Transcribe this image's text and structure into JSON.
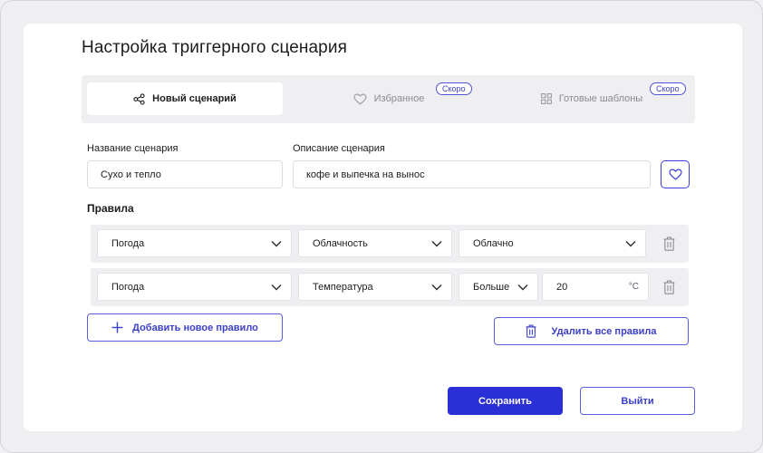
{
  "page": {
    "title": "Настройка триггерного сценария"
  },
  "tabs": [
    {
      "label": "Новый сценарий",
      "icon": "share-nodes-icon",
      "active": true
    },
    {
      "label": "Избранное",
      "icon": "heart-icon",
      "badge": "Скоро"
    },
    {
      "label": "Готовые шаблоны",
      "icon": "grid-icon",
      "badge": "Скоро"
    }
  ],
  "form": {
    "name_label": "Название сценария",
    "name_value": "Сухо и тепло",
    "description_label": "Описание сценария",
    "description_value": "кофе и выпечка на вынос",
    "favorite_icon": "heart-icon"
  },
  "rules": {
    "title": "Правила",
    "rows": [
      {
        "source": "Погода",
        "parameter": "Облачность",
        "condition": "Облачно"
      },
      {
        "source": "Погода",
        "parameter": "Температура",
        "operator": "Больше",
        "value": "20",
        "unit": "°C"
      }
    ],
    "add_label": "Добавить новое правило",
    "delete_all_label": "Удалить все правила"
  },
  "actions": {
    "save_label": "Сохранить",
    "exit_label": "Выйти"
  },
  "colors": {
    "accent": "#2b2fd6",
    "outline": "#5a5ed9",
    "tab_bg": "#efeff2"
  }
}
